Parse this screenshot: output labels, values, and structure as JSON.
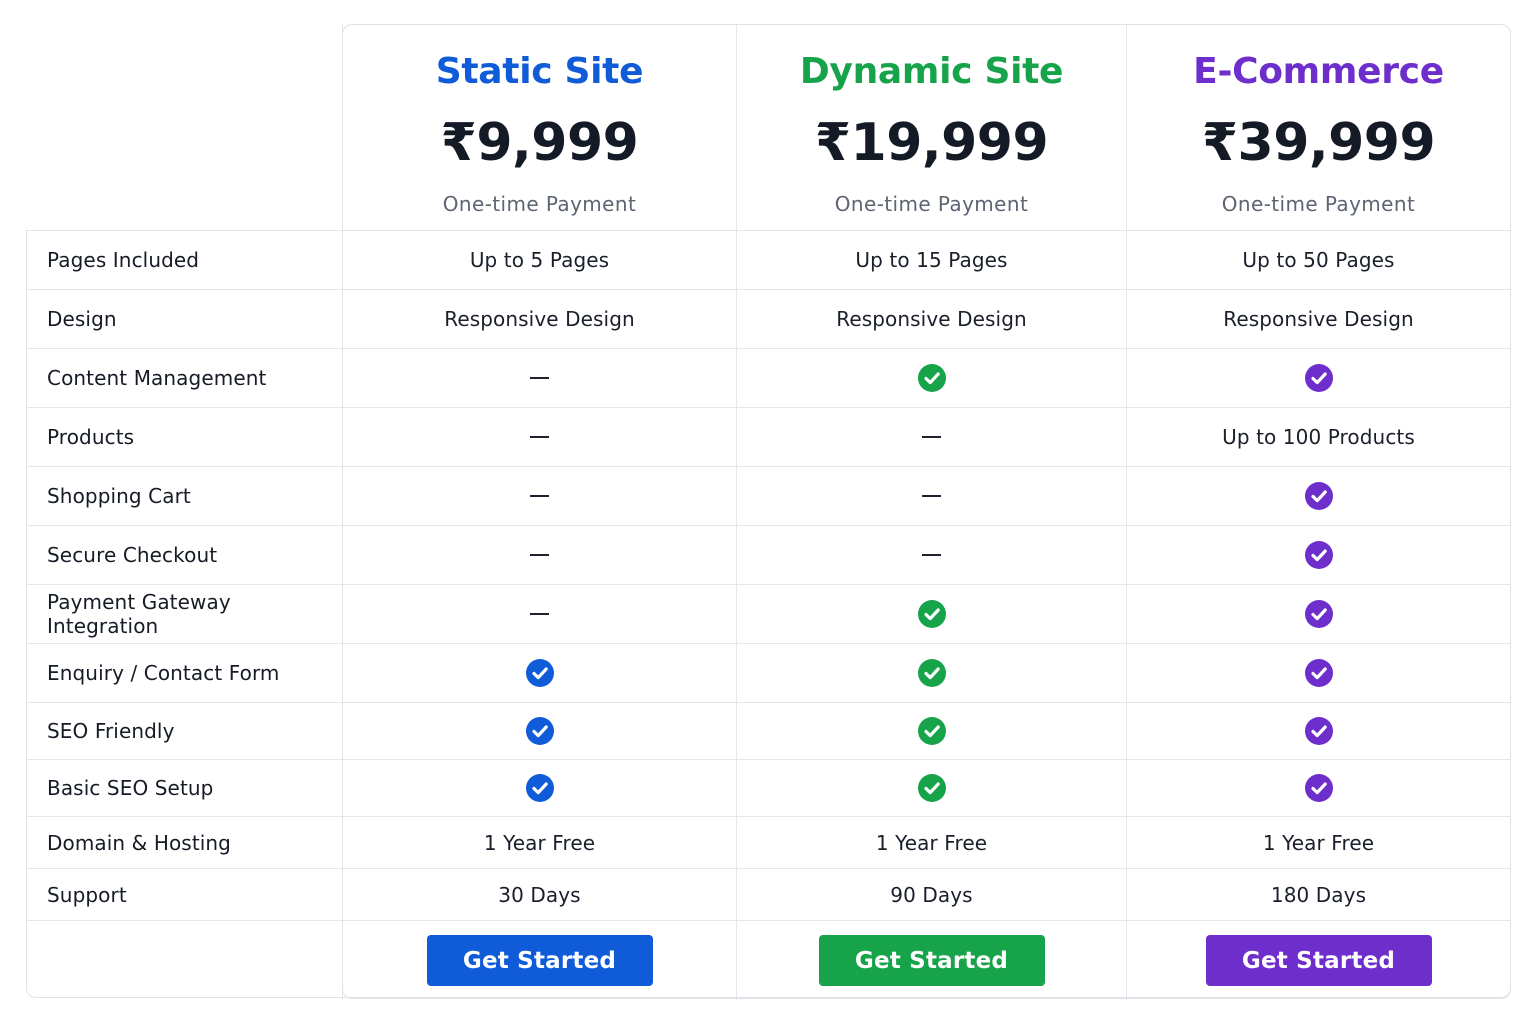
{
  "plans": [
    {
      "name": "Static Site",
      "price": "₹9,999",
      "note": "One-time Payment",
      "color": "#0f5bd8",
      "button_label": "Get Started"
    },
    {
      "name": "Dynamic Site",
      "price": "₹19,999",
      "note": "One-time Payment",
      "color": "#17a34a",
      "button_label": "Get Started"
    },
    {
      "name": "E-Commerce",
      "price": "₹39,999",
      "note": "One-time Payment",
      "color": "#6d2ecb",
      "button_label": "Get Started"
    }
  ],
  "features": [
    {
      "label": "Pages Included",
      "values": [
        "Up to 5 Pages",
        "Up to 15 Pages",
        "Up to 50 Pages"
      ]
    },
    {
      "label": "Design",
      "values": [
        "Responsive Design",
        "Responsive Design",
        "Responsive Design"
      ]
    },
    {
      "label": "Content Management",
      "values": [
        "dash",
        "check",
        "check"
      ]
    },
    {
      "label": "Products",
      "values": [
        "dash",
        "dash",
        "Up to 100 Products"
      ]
    },
    {
      "label": "Shopping Cart",
      "values": [
        "dash",
        "dash",
        "check"
      ]
    },
    {
      "label": "Secure Checkout",
      "values": [
        "dash",
        "dash",
        "check"
      ]
    },
    {
      "label": "Payment Gateway Integration",
      "values": [
        "dash",
        "check",
        "check"
      ]
    },
    {
      "label": "Enquiry / Contact Form",
      "values": [
        "check",
        "check",
        "check"
      ]
    },
    {
      "label": "SEO Friendly",
      "values": [
        "check",
        "check",
        "check"
      ]
    },
    {
      "label": "Basic SEO Setup",
      "values": [
        "check",
        "check",
        "check"
      ]
    },
    {
      "label": "Domain & Hosting",
      "values": [
        "1 Year Free",
        "1 Year Free",
        "1 Year Free"
      ]
    },
    {
      "label": "Support",
      "values": [
        "30 Days",
        "90 Days",
        "180 Days"
      ]
    }
  ]
}
